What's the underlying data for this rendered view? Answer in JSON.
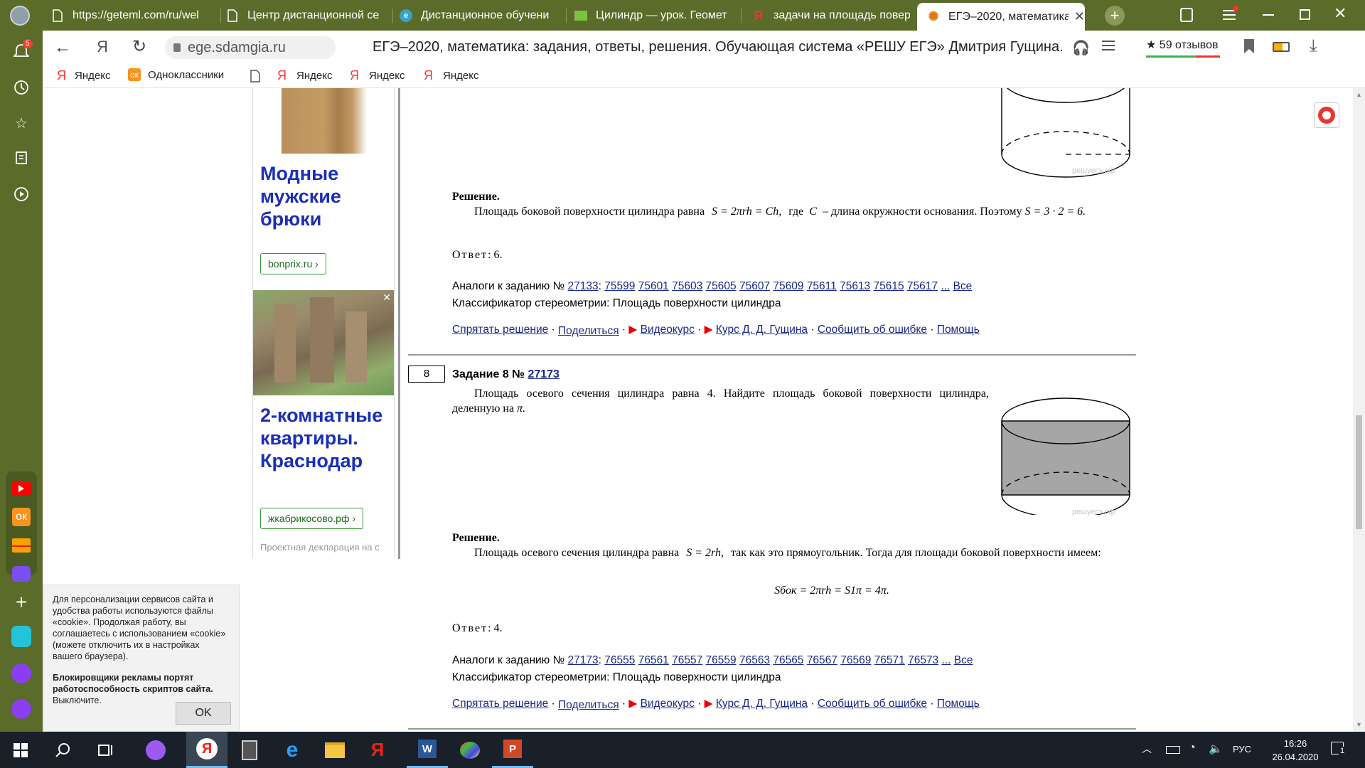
{
  "tabs": [
    {
      "title": "https://geteml.com/ru/wel",
      "icon": "page-icon"
    },
    {
      "title": "Центр дистанционной се",
      "icon": "page-icon"
    },
    {
      "title": "Дистанционное обучени",
      "icon": "globe-icon"
    },
    {
      "title": "Цилиндр — урок. Геомет",
      "icon": "book-icon"
    },
    {
      "title": "задачи на площадь повер",
      "icon": "yandex-icon"
    },
    {
      "title": "ЕГЭ–2020, математика",
      "icon": "sun-icon"
    }
  ],
  "toolbar": {
    "domain": "ege.sdamgia.ru",
    "page_title": "ЕГЭ–2020, математика: задания, ответы, решения. Обучающая система «РЕШУ ЕГЭ» Дмитрия Гущина.",
    "reviews": "★ 59 отзывов"
  },
  "sidebar_badge": "5",
  "bookmarks": [
    {
      "label": "Яндекс",
      "icon": "yandex-icon"
    },
    {
      "label": "Одноклассники",
      "icon": "ok-icon"
    },
    {
      "label": "",
      "icon": "page-icon"
    },
    {
      "label": "Яндекс",
      "icon": "yandex-icon"
    },
    {
      "label": "Яндекс",
      "icon": "yandex-icon"
    },
    {
      "label": "Яндекс",
      "icon": "yandex-icon"
    }
  ],
  "ads": {
    "ad1_title": "Модные мужские брюки",
    "ad1_button": "bonprix.ru",
    "ad2_title": "2-комнатные квартиры. Краснодар",
    "ad2_button": "жкабрикосово.рф",
    "ad2_footer": "Проектная декларация на с"
  },
  "cookie": {
    "text": "Для персонализации сервисов сайта и удобства работы используются файлы «cookie». Продолжая работу, вы соглашаетесь с использованием «cookie» (можете отключить их в настройках вашего браузера).",
    "warning_bold": "Блокировщики рекламы портят работоспособность скриптов сайта.",
    "warning_tail": "Выключите.",
    "ok": "OK"
  },
  "task7": {
    "solution_heading": "Решение.",
    "solution_text_1": "Площадь боковой поверхности цилиндра равна",
    "formula_1": "S = 2πrh = Ch,",
    "solution_text_2": "где",
    "var_c": "C",
    "solution_text_3": "– длина окружности основания. Поэтому",
    "formula_2": "S = 3 · 2 = 6.",
    "answer_label": "Ответ",
    "answer_value": ": 6.",
    "analogs_label": "Аналоги к заданию №",
    "analogs_id": "27133",
    "analogs_list": [
      "75599",
      "75601",
      "75603",
      "75605",
      "75607",
      "75609",
      "75611",
      "75613",
      "75615",
      "75617"
    ],
    "ellipsis": "...",
    "all": "Все",
    "classifier_label": "Классификатор стереометрии:",
    "classifier_link": "Площадь поверхности цилиндра",
    "watermark": "решуегэ.рф"
  },
  "task8": {
    "number": "8",
    "heading": "Задание 8 №",
    "id": "27173",
    "condition": "Площадь осевого сечения цилиндра равна 4. Найдите площадь боковой поверхности цилиндра, деленную на",
    "pi": "π.",
    "solution_heading": "Решение.",
    "solution_text_1": "Площадь осевого сечения цилиндра равна",
    "formula_1": "S = 2rh,",
    "solution_text_2": "так как это прямоугольник. Тогда для площади боковой поверхности имеем:",
    "formula_block": "Sбок = 2πrh = S1π = 4π.",
    "answer_label": "Ответ",
    "answer_value": ": 4.",
    "analogs_label": "Аналоги к заданию №",
    "analogs_id": "27173",
    "analogs_list": [
      "76555",
      "76561",
      "76557",
      "76559",
      "76563",
      "76565",
      "76567",
      "76569",
      "76571",
      "76573"
    ],
    "ellipsis": "...",
    "all": "Все",
    "classifier_label": "Классификатор стереометрии:",
    "classifier_link": "Площадь поверхности цилиндра",
    "watermark": "решуегэ.рф"
  },
  "actions": {
    "hide": "Спрятать решение",
    "share": "Поделиться",
    "video": "Видеокурс",
    "course": "Курс Д. Д. Гущина",
    "report": "Сообщить об ошибке",
    "help": "Помощь"
  },
  "tray": {
    "lang": "РУС",
    "time": "16:26",
    "date": "26.04.2020",
    "notif": "1"
  }
}
